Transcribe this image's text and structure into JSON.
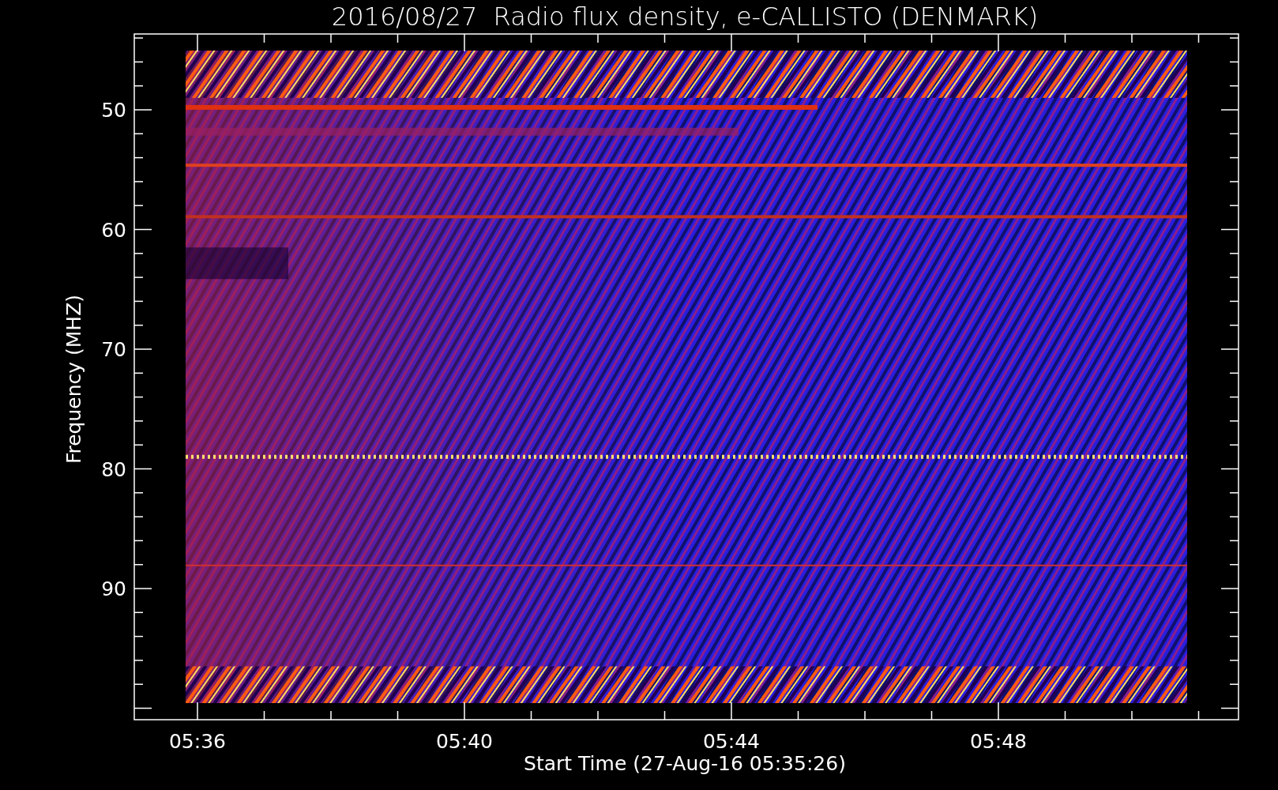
{
  "title": "2016/08/27  Radio flux density, e-CALLISTO (DENMARK)",
  "y_axis": {
    "label": "Frequency (MHZ)",
    "ticks": [
      "50",
      "60",
      "70",
      "80",
      "90"
    ]
  },
  "x_axis": {
    "label": "Start Time (27-Aug-16 05:35:26)",
    "ticks": [
      "05:36",
      "05:40",
      "05:44",
      "05:48"
    ]
  }
}
